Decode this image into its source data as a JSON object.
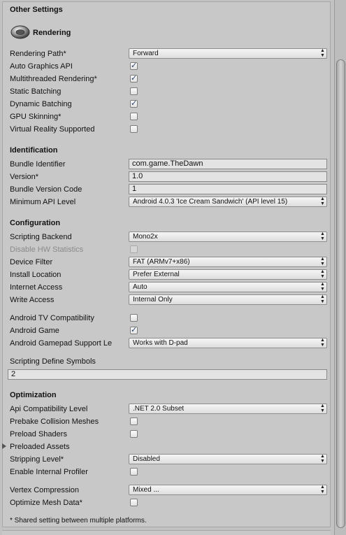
{
  "header": {
    "title": "Other Settings"
  },
  "rendering": {
    "title": "Rendering",
    "rendering_path": {
      "label": "Rendering Path*",
      "value": "Forward"
    },
    "auto_graphics_api": {
      "label": "Auto Graphics API",
      "checked": true
    },
    "multithreaded_rendering": {
      "label": "Multithreaded Rendering*",
      "checked": true
    },
    "static_batching": {
      "label": "Static Batching",
      "checked": false
    },
    "dynamic_batching": {
      "label": "Dynamic Batching",
      "checked": true
    },
    "gpu_skinning": {
      "label": "GPU Skinning*",
      "checked": false
    },
    "vr_supported": {
      "label": "Virtual Reality Supported",
      "checked": false
    }
  },
  "identification": {
    "title": "Identification",
    "bundle_identifier": {
      "label": "Bundle Identifier",
      "value": "com.game.TheDawn"
    },
    "version": {
      "label": "Version*",
      "value": "1.0"
    },
    "bundle_version_code": {
      "label": "Bundle Version Code",
      "value": "1"
    },
    "min_api_level": {
      "label": "Minimum API Level",
      "value": "Android 4.0.3 'Ice Cream Sandwich' (API level 15)"
    }
  },
  "configuration": {
    "title": "Configuration",
    "scripting_backend": {
      "label": "Scripting Backend",
      "value": "Mono2x"
    },
    "disable_hw_statistics": {
      "label": "Disable HW Statistics",
      "checked": false
    },
    "device_filter": {
      "label": "Device Filter",
      "value": "FAT (ARMv7+x86)"
    },
    "install_location": {
      "label": "Install Location",
      "value": "Prefer External"
    },
    "internet_access": {
      "label": "Internet Access",
      "value": "Auto"
    },
    "write_access": {
      "label": "Write Access",
      "value": "Internal Only"
    },
    "android_tv": {
      "label": "Android TV Compatibility",
      "checked": false
    },
    "android_game": {
      "label": "Android Game",
      "checked": true
    },
    "gamepad_support": {
      "label": "Android Gamepad Support Le",
      "value": "Works with D-pad"
    },
    "scripting_define_symbols": {
      "label": "Scripting Define Symbols",
      "value": "2"
    }
  },
  "optimization": {
    "title": "Optimization",
    "api_compat_level": {
      "label": "Api Compatibility Level",
      "value": ".NET 2.0 Subset"
    },
    "prebake_collision": {
      "label": "Prebake Collision Meshes",
      "checked": false
    },
    "preload_shaders": {
      "label": "Preload Shaders",
      "checked": false
    },
    "preloaded_assets": {
      "label": "Preloaded Assets"
    },
    "stripping_level": {
      "label": "Stripping Level*",
      "value": "Disabled"
    },
    "internal_profiler": {
      "label": "Enable Internal Profiler",
      "checked": false
    },
    "vertex_compression": {
      "label": "Vertex Compression",
      "value": "Mixed ..."
    },
    "optimize_mesh": {
      "label": "Optimize Mesh Data*",
      "checked": false
    }
  },
  "footer": {
    "note": "* Shared setting between multiple platforms."
  },
  "icons": {
    "rendering": "rendering-sphere-icon",
    "dropdown": "updown-arrows-icon",
    "check": "checkmark-icon",
    "foldout": "triangle-right-icon"
  },
  "colors": {
    "panel": "#c8c8c8",
    "check": "#2a3f6b"
  }
}
